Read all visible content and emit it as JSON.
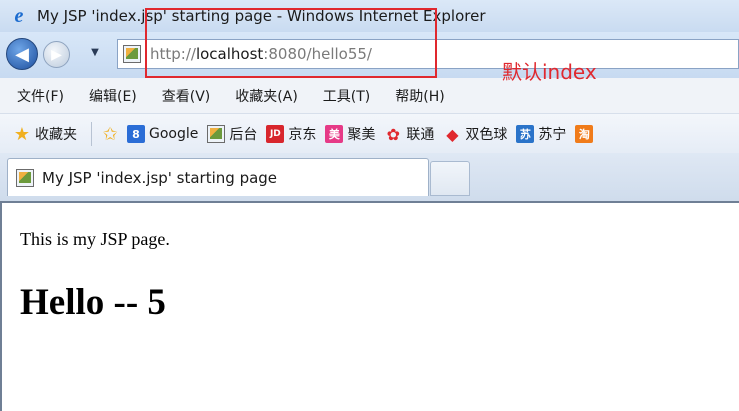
{
  "window": {
    "title": "My JSP 'index.jsp' starting page - Windows Internet Explorer"
  },
  "address_bar": {
    "url_prefix": "http://",
    "url_host": "localhost",
    "url_rest": ":8080/hello55/"
  },
  "annotation": {
    "text": "默认index",
    "color": "#e0282e"
  },
  "menu": {
    "items": [
      "文件(F)",
      "编辑(E)",
      "查看(V)",
      "收藏夹(A)",
      "工具(T)",
      "帮助(H)"
    ]
  },
  "favorites": {
    "main_label": "收藏夹",
    "items": [
      {
        "label": "Google",
        "icon": "google-icon",
        "color": "#2b6dd6",
        "glyph": "8"
      },
      {
        "label": "后台",
        "icon": "page-icon",
        "color": "#eef3f8",
        "glyph": ""
      },
      {
        "label": "京东",
        "icon": "jd-icon",
        "color": "#d8262d",
        "glyph": "JD"
      },
      {
        "label": "聚美",
        "icon": "jumei-icon",
        "color": "#e63a87",
        "glyph": "美"
      },
      {
        "label": "联通",
        "icon": "unicom-icon",
        "color": "#e0282e",
        "glyph": "✿"
      },
      {
        "label": "双色球",
        "icon": "lottery-icon",
        "color": "#e0282e",
        "glyph": "◆"
      },
      {
        "label": "苏宁",
        "icon": "suning-icon",
        "color": "#2a73c9",
        "glyph": "苏"
      }
    ]
  },
  "tab": {
    "label": "My JSP 'index.jsp' starting page"
  },
  "page": {
    "paragraph": "This is my JSP page.",
    "heading": "Hello -- 5"
  }
}
